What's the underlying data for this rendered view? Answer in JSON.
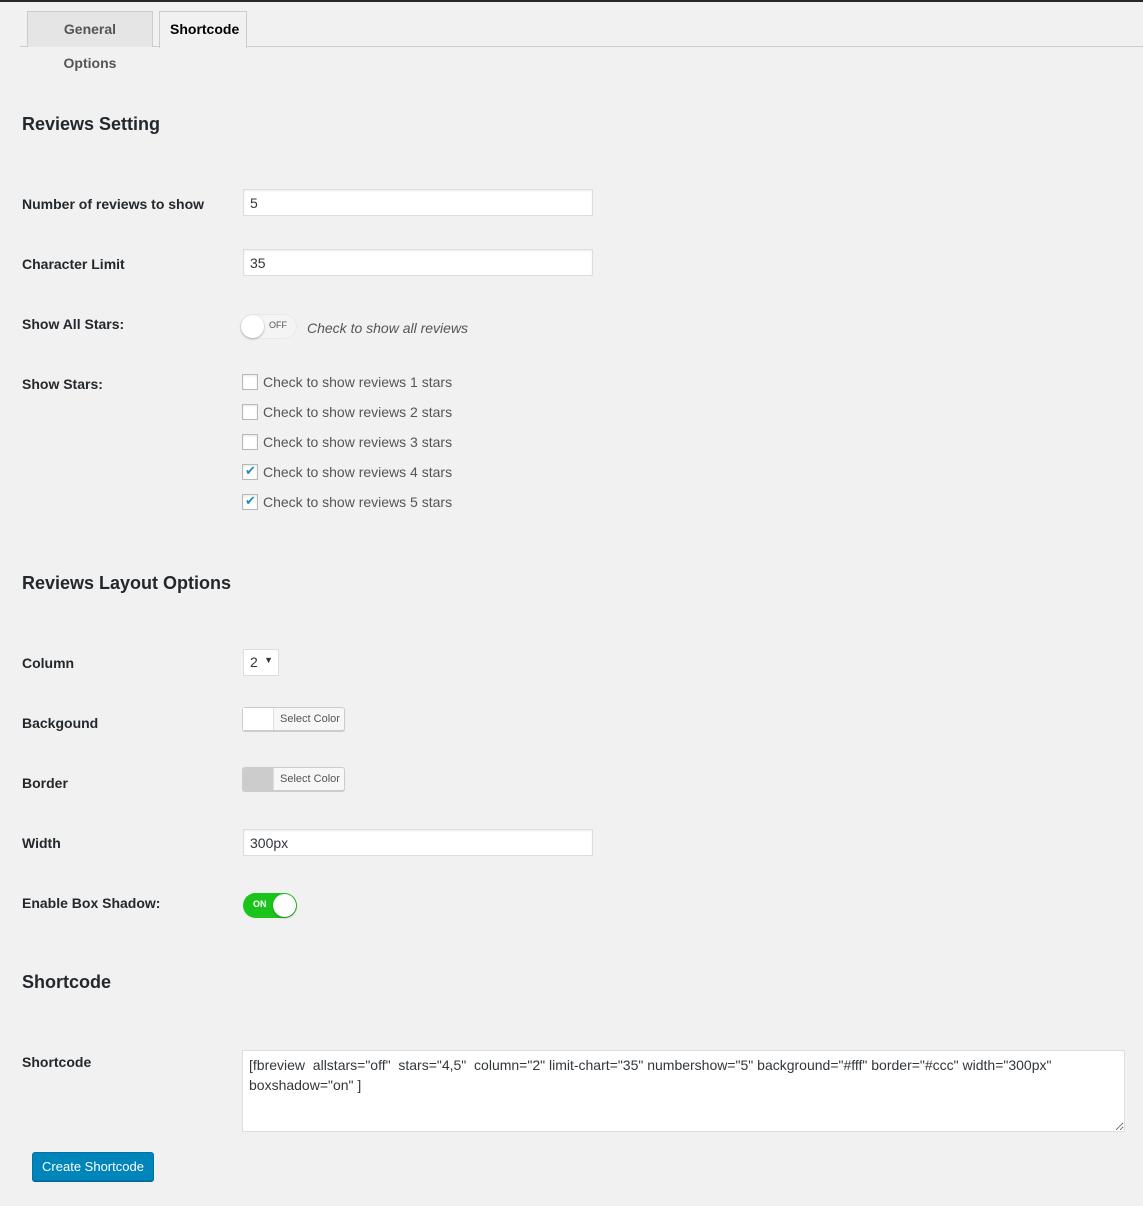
{
  "tabs": [
    {
      "label": "General Options",
      "active": false
    },
    {
      "label": "Shortcode",
      "active": true
    }
  ],
  "reviews_setting": {
    "heading": "Reviews Setting",
    "num_reviews": {
      "label": "Number of reviews to show",
      "value": "5"
    },
    "char_limit": {
      "label": "Character Limit",
      "value": "35"
    },
    "show_all_stars": {
      "label": "Show All Stars:",
      "toggle_text": "OFF",
      "state": "off",
      "hint": "Check to show all reviews"
    },
    "show_stars": {
      "label": "Show Stars:",
      "options": [
        {
          "label": "Check to show reviews 1 stars",
          "checked": false
        },
        {
          "label": "Check to show reviews 2 stars",
          "checked": false
        },
        {
          "label": "Check to show reviews 3 stars",
          "checked": false
        },
        {
          "label": "Check to show reviews 4 stars",
          "checked": true
        },
        {
          "label": "Check to show reviews 5 stars",
          "checked": true
        }
      ]
    }
  },
  "layout": {
    "heading": "Reviews Layout Options",
    "column": {
      "label": "Column",
      "value": "2"
    },
    "background": {
      "label": "Backgound",
      "button": "Select Color",
      "color": "#ffffff"
    },
    "border": {
      "label": "Border",
      "button": "Select Color",
      "color": "#cccccc"
    },
    "width": {
      "label": "Width",
      "value": "300px"
    },
    "box_shadow": {
      "label": "Enable Box Shadow:",
      "toggle_text": "ON",
      "state": "on",
      "color": "#1bc41b"
    }
  },
  "shortcode": {
    "heading": "Shortcode",
    "label": "Shortcode",
    "value": "[fbreview  allstars=\"off\"  stars=\"4,5\"  column=\"2\" limit-chart=\"35\" numbershow=\"5\" background=\"#fff\" border=\"#ccc\" width=\"300px\" boxshadow=\"on\" ]",
    "button": "Create Shortcode"
  }
}
